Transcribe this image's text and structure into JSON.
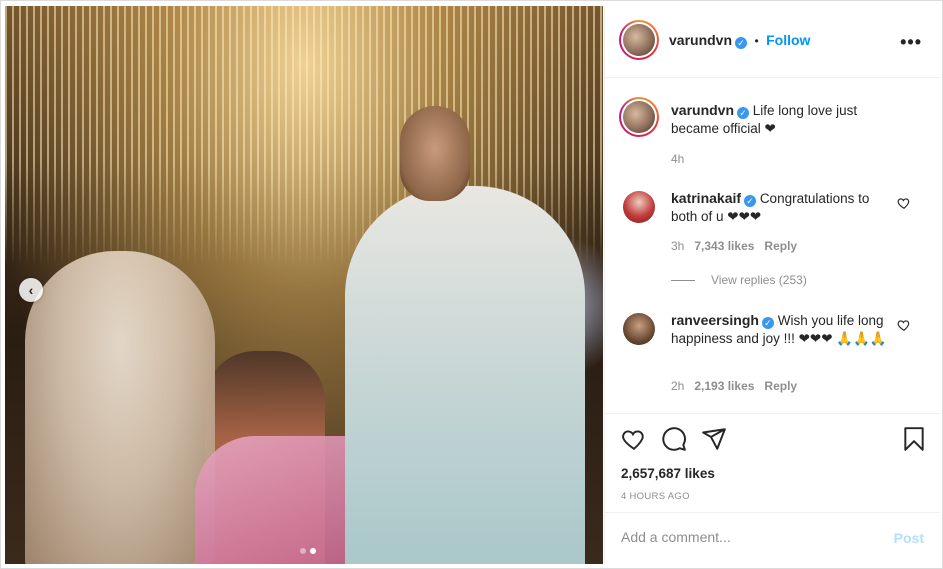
{
  "post": {
    "carousel": {
      "slide_count": 2,
      "active_slide": 2
    }
  },
  "header": {
    "username": "varundvn",
    "separator": "•",
    "follow_label": "Follow",
    "more_label": "•••"
  },
  "caption": {
    "username": "varundvn",
    "text": "Life long love just became official ❤",
    "time": "4h"
  },
  "comments": [
    {
      "username": "katrinakaif",
      "text": "Congratulations to both of u ❤❤❤",
      "time": "3h",
      "likes": "7,343 likes",
      "reply_label": "Reply"
    },
    {
      "username": "ranveersingh",
      "text": "Wish you life long happiness and joy !!! ❤❤❤ 🙏🙏🙏",
      "time": "2h",
      "likes": "2,193 likes",
      "reply_label": "Reply"
    }
  ],
  "view_replies": "View replies (253)",
  "actions": {
    "likes_count": "2,657,687 likes",
    "timestamp": "4 HOURS AGO"
  },
  "add_comment": {
    "placeholder": "Add a comment...",
    "post_label": "Post"
  },
  "colors": {
    "link_blue": "#0095f6",
    "verified_blue": "#3897f0",
    "muted_gray": "#8e8e8e"
  },
  "icons": {
    "verified": "verified-badge-icon",
    "more": "more-options-icon",
    "like": "heart-icon",
    "comment": "comment-bubble-icon",
    "share": "paper-plane-icon",
    "save": "bookmark-icon",
    "prev": "chevron-left-icon"
  }
}
